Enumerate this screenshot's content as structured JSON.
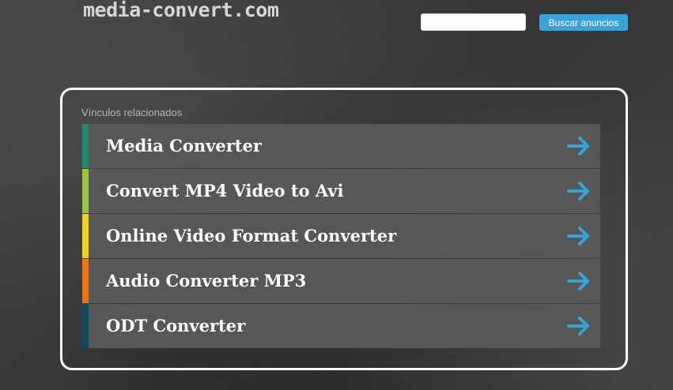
{
  "header": {
    "logo": "media-convert.com",
    "search_value": "",
    "search_button": "Buscar anuncios"
  },
  "related": {
    "title": "Vínculos relacionados",
    "items": [
      {
        "label": "Media Converter",
        "color": "#1f8a6d",
        "icon": "arrow-right-icon"
      },
      {
        "label": "Convert MP4 Video to Avi",
        "color": "#9cc43a",
        "icon": "arrow-right-icon"
      },
      {
        "label": "Online Video Format Converter",
        "color": "#f2d21a",
        "icon": "arrow-right-icon"
      },
      {
        "label": "Audio Converter MP3",
        "color": "#f0730f",
        "icon": "arrow-right-icon"
      },
      {
        "label": "ODT Converter",
        "color": "#0f4a5c",
        "icon": "arrow-right-icon"
      }
    ]
  },
  "colors": {
    "accent": "#3aa3d6",
    "arrow": "#3aa3d6"
  }
}
